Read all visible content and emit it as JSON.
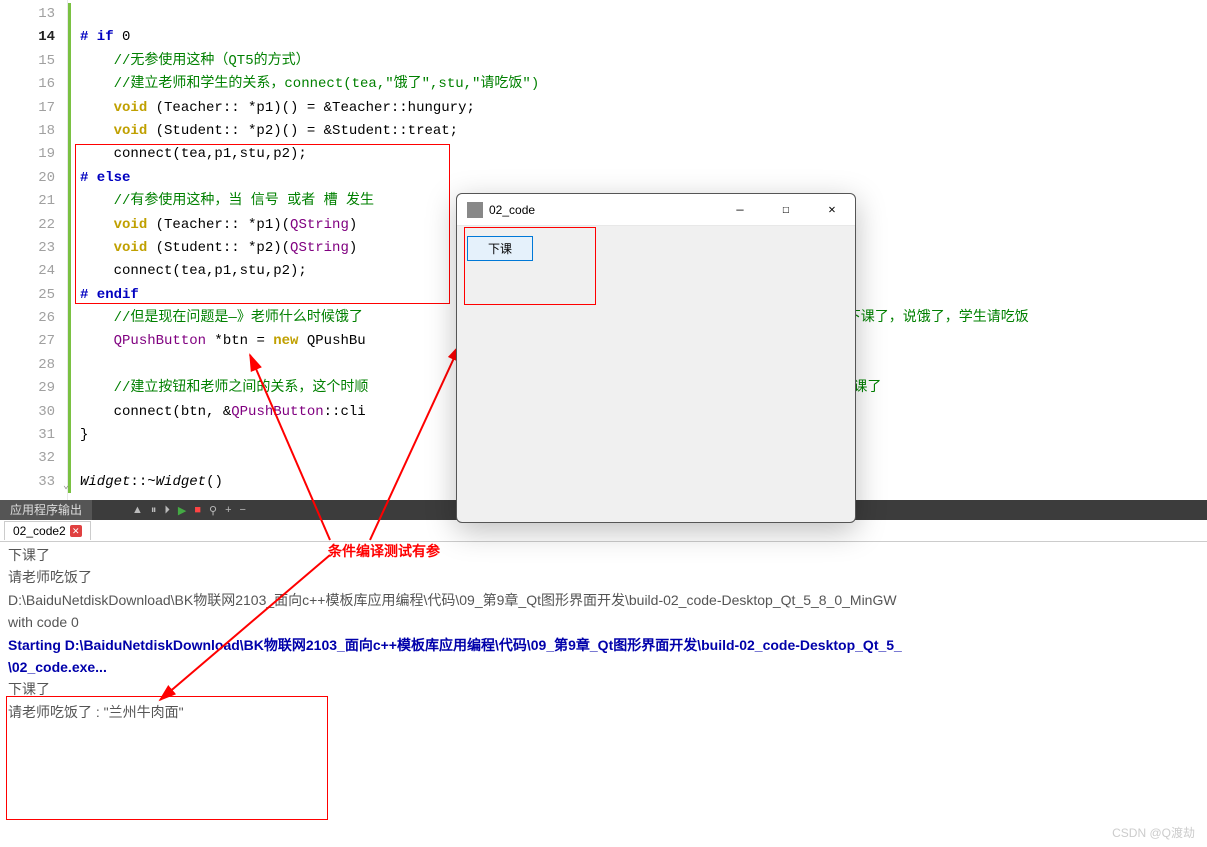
{
  "gutter": {
    "start": 13,
    "end": 33,
    "current": 14
  },
  "code": {
    "l13": "",
    "l14_a": "# if",
    "l14_b": " 0",
    "l15": "    //无参使用这种（QT5的方式）",
    "l16": "    //建立老师和学生的关系，connect(tea,\"饿了\",stu,\"请吃饭\")",
    "l17_a": "    ",
    "l17_b": "void",
    "l17_c": " (Teacher:: *p1)() = &Teacher::hungury;",
    "l18_a": "    ",
    "l18_b": "void",
    "l18_c": " (Student:: *p2)() = &Student::treat;",
    "l19": "    connect(tea,p1,stu,p2);",
    "l20": "# else",
    "l21": "    //有参使用这种，当 信号 或者 槽 发生",
    "l22_a": "    ",
    "l22_b": "void",
    "l22_c": " (Teacher:: *p1)(",
    "l22_d": "QString",
    "l22_e": ")",
    "l23_a": "    ",
    "l23_b": "void",
    "l23_c": " (Student:: *p2)(",
    "l23_d": "QString",
    "l23_e": ")",
    "l24": "    connect(tea,p1,stu,p2);",
    "l25": "# endif",
    "l26_a": "    ",
    "l26_b": "//但是现在问题是—》老师什么时候饿了",
    "l26_c": "按钮时，老师下课了，说饿了，学生请吃饭",
    "l27_a": "    ",
    "l27_b": "QPushButton",
    "l27_c": " *btn = ",
    "l27_d": "new",
    "l27_e": " QPushBu",
    "l28": "",
    "l29_a": "    ",
    "l29_b": "//建立按钮和老师之间的关系，这个时顺",
    "l29_c": "钮，老师下课了",
    "l30_a": "    connect(btn, &",
    "l30_b": "QPushButton",
    "l30_c": "::cli",
    "l31": "}",
    "l32": "",
    "l33_a": "Widget",
    "l33_b": "::~",
    "l33_c": "Widget",
    "l33_d": "()"
  },
  "annotation": "条件编译测试有参",
  "output": {
    "panel_title": "应用程序输出",
    "tab_name": "02_code2",
    "line1": "下课了",
    "line2": "",
    "line3": "请老师吃饭了",
    "line4": "",
    "line5": "D:\\BaiduNetdiskDownload\\BK物联网2103_面向c++模板库应用编程\\代码\\09_第9章_Qt图形界面开发\\build-02_code-Desktop_Qt_5_8_0_MinGW",
    "line6": "with code 0",
    "line7": "",
    "line8": "Starting D:\\BaiduNetdiskDownload\\BK物联网2103_面向c++模板库应用编程\\代码\\09_第9章_Qt图形界面开发\\build-02_code-Desktop_Qt_5_",
    "line9": "\\02_code.exe...",
    "line10": "下课了",
    "line11": "",
    "line12": "请老师吃饭了 : \"兰州牛肉面\""
  },
  "qt": {
    "title": "02_code",
    "button": "下课"
  },
  "watermark": "CSDN @Q渡劫"
}
